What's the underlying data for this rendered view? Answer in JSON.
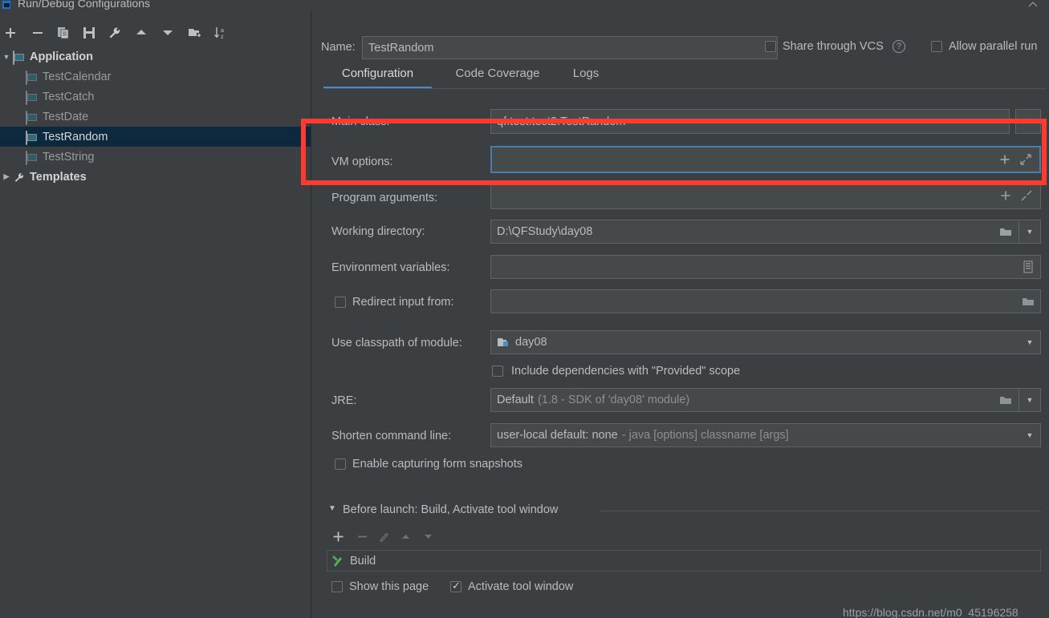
{
  "window": {
    "title": "Run/Debug Configurations",
    "app_icon": "idea-icon",
    "collapse_icon": "chevron-up-icon",
    "close_icon": "close-icon"
  },
  "toolbar": {
    "buttons": [
      {
        "name": "add-configuration-button",
        "icon": "plus-icon",
        "label": "+"
      },
      {
        "name": "remove-configuration-button",
        "icon": "minus-icon",
        "label": "−"
      },
      {
        "name": "copy-configuration-button",
        "icon": "copy-icon",
        "label": "Copy"
      },
      {
        "name": "save-configuration-button",
        "icon": "save-icon",
        "label": "Save"
      },
      {
        "name": "edit-templates-button",
        "icon": "wrench-icon",
        "label": "Edit Templates"
      },
      {
        "name": "move-up-button",
        "icon": "arrow-up-icon",
        "label": "Move Up"
      },
      {
        "name": "move-down-button",
        "icon": "arrow-down-icon",
        "label": "Move Down"
      },
      {
        "name": "new-folder-button",
        "icon": "folder-add-icon",
        "label": "New Folder"
      },
      {
        "name": "sort-configurations-button",
        "icon": "sort-az-icon",
        "label": "Sort"
      }
    ]
  },
  "tree": {
    "nodes": [
      {
        "label": "Application",
        "type": "group",
        "expanded": true,
        "icon": "application-icon",
        "selected": false
      },
      {
        "label": "TestCalendar",
        "type": "child",
        "icon": "application-icon",
        "selected": false
      },
      {
        "label": "TestCatch",
        "type": "child",
        "icon": "application-icon",
        "selected": false
      },
      {
        "label": "TestDate",
        "type": "child",
        "icon": "application-icon",
        "selected": false
      },
      {
        "label": "TestRandom",
        "type": "child",
        "icon": "application-icon",
        "selected": true
      },
      {
        "label": "TestString",
        "type": "child",
        "icon": "application-icon",
        "selected": false
      },
      {
        "label": "Templates",
        "type": "group",
        "expanded": false,
        "icon": "wrench-icon",
        "selected": false
      }
    ]
  },
  "header": {
    "name_label": "Name:",
    "name_value": "TestRandom",
    "share_vcs_label": "Share through VCS",
    "share_vcs_checked": false,
    "help_icon": "question-mark-icon",
    "allow_parallel_label": "Allow parallel run",
    "allow_parallel_checked": false
  },
  "tabs": [
    {
      "label": "Configuration",
      "active": true
    },
    {
      "label": "Code Coverage",
      "active": false
    },
    {
      "label": "Logs",
      "active": false
    }
  ],
  "form": {
    "main_class": {
      "label": "Main class:",
      "value": "qf.test.test2.TestRandom",
      "browse_icon": "browse-icon"
    },
    "vm_options": {
      "label": "VM options:",
      "value": "",
      "focused": true,
      "macro_icon": "plus-icon",
      "expand_icon": "expand-icon"
    },
    "program_arguments": {
      "label": "Program arguments:",
      "value": "",
      "macro_icon": "plus-icon",
      "expand_icon": "expand-icon"
    },
    "working_directory": {
      "label": "Working directory:",
      "value": "D:\\QFStudy\\day08",
      "browse_icon": "folder-icon",
      "dropdown_icon": "chevron-down-icon"
    },
    "environment_variables": {
      "label": "Environment variables:",
      "value": "",
      "edit_icon": "list-icon"
    },
    "redirect_input": {
      "label": "Redirect input from:",
      "checked": false,
      "value": "",
      "browse_icon": "folder-icon"
    },
    "classpath_module": {
      "label": "Use classpath of module:",
      "value": "day08",
      "module_icon": "module-icon",
      "dropdown_icon": "chevron-down-icon"
    },
    "include_dependencies": {
      "label": "Include dependencies with \"Provided\" scope",
      "checked": false
    },
    "jre": {
      "label": "JRE:",
      "value": "Default",
      "value_hint": "(1.8 - SDK of 'day08' module)",
      "browse_icon": "folder-icon",
      "dropdown_icon": "chevron-down-icon"
    },
    "shorten_command_line": {
      "label": "Shorten command line:",
      "value": "user-local default: none",
      "value_hint": "- java [options] classname [args]",
      "dropdown_icon": "chevron-down-icon"
    },
    "form_snapshots": {
      "label": "Enable capturing form snapshots",
      "checked": false
    }
  },
  "before_launch": {
    "header": "Before launch: Build, Activate tool window",
    "expanded": true,
    "expand_icon": "triangle-down-icon",
    "toolbar": [
      {
        "name": "add-task-button",
        "icon": "plus-icon",
        "label": "+",
        "disabled": false
      },
      {
        "name": "remove-task-button",
        "icon": "minus-icon",
        "label": "−",
        "disabled": true
      },
      {
        "name": "edit-task-button",
        "icon": "pencil-icon",
        "label": "Edit",
        "disabled": true
      },
      {
        "name": "move-task-up-button",
        "icon": "arrow-up-icon",
        "label": "Up",
        "disabled": true
      },
      {
        "name": "move-task-down-button",
        "icon": "arrow-down-icon",
        "label": "Down",
        "disabled": true
      }
    ],
    "tasks": [
      {
        "label": "Build",
        "icon": "build-hammer-icon"
      }
    ],
    "show_this_page": {
      "label": "Show this page",
      "checked": false
    },
    "activate_tool_window": {
      "label": "Activate tool window",
      "checked": true
    }
  },
  "annotation": {
    "highlight_color": "#ff3b30",
    "target": "vm-options-row"
  },
  "watermark": {
    "text": "https://blog.csdn.net/m0_45196258"
  },
  "colors": {
    "background": "#3c3f41",
    "field_background": "#45494a",
    "focus_border": "#4a7cb0",
    "selection": "#0d293e",
    "text": "#bbbbbb",
    "muted_text": "#8f8f8f",
    "accent_tab": "#4a88c7",
    "build_icon": "#54b35a"
  }
}
